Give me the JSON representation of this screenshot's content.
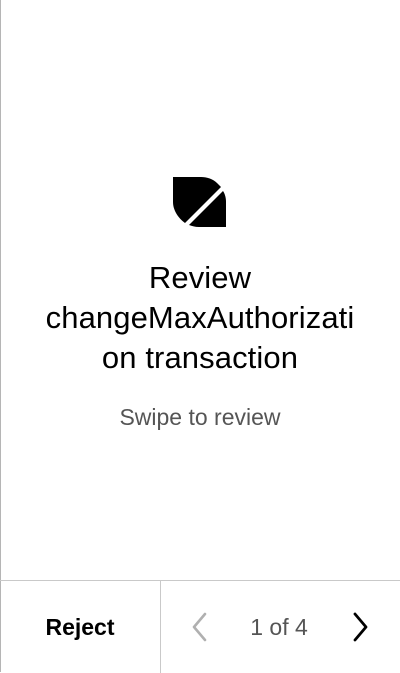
{
  "review": {
    "title_lines": [
      "Review",
      "changeMaxAuthorizati",
      "on transaction"
    ],
    "subtitle": "Swipe to review",
    "logo_icon": "ontology-logo-icon"
  },
  "footer": {
    "reject_label": "Reject",
    "pagination": "1 of 4",
    "prev_icon": "chevron-left-icon",
    "next_icon": "chevron-right-icon"
  },
  "colors": {
    "text": "#000000",
    "secondary_text": "#555555",
    "disabled_icon": "#b0b0b0",
    "divider": "#c9c9c9",
    "background": "#ffffff"
  }
}
